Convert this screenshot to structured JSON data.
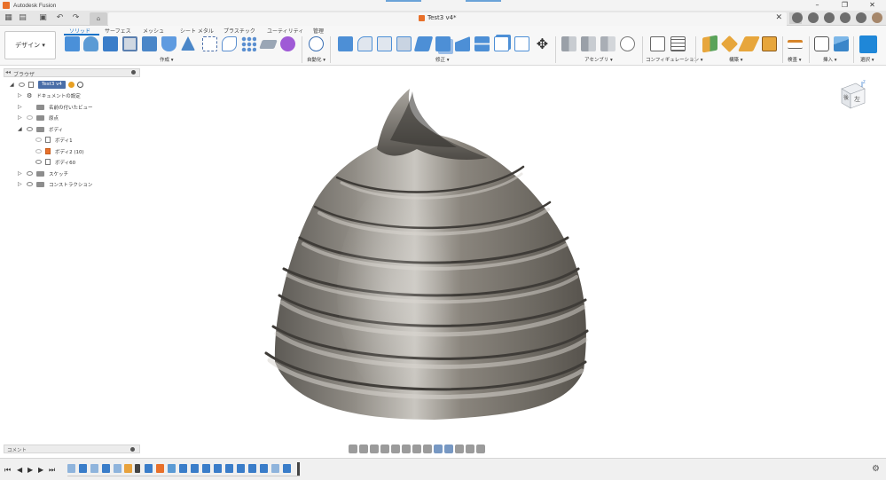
{
  "window": {
    "title": "Autodesk Fusion"
  },
  "document": {
    "tab_title": "Test3 v4*"
  },
  "ribbon": {
    "workspace_button": "デザイン ▾",
    "tabs": [
      "ソリッド",
      "サーフェス",
      "メッシュ",
      "シート メタル",
      "プラスチック",
      "ユーティリティ",
      "管理"
    ],
    "active_tab": "ソリッド",
    "groups": [
      "作成 ▾",
      "自動化 ▾",
      "修正 ▾",
      "アセンブリ ▾",
      "コンフィギュレーション ▾",
      "構築 ▾",
      "検査 ▾",
      "挿入 ▾",
      "選択 ▾"
    ]
  },
  "browser": {
    "title": "ブラウザ",
    "root": "Test3 v4",
    "items": [
      {
        "label": "ドキュメントの設定"
      },
      {
        "label": "名前の付いたビュー"
      },
      {
        "label": "原点"
      },
      {
        "label": "ボディ"
      },
      {
        "label": "ボディ1"
      },
      {
        "label": "ボディ2 (10)"
      },
      {
        "label": "ボディ60"
      },
      {
        "label": "スケッチ"
      },
      {
        "label": "コンストラクション"
      }
    ]
  },
  "viewcube": {
    "face_back": "後",
    "face_left": "左",
    "axis_z": "Z"
  },
  "comments": {
    "title": "コメント"
  },
  "colors": {
    "accent": "#1a73c8",
    "brand_orange": "#e8702a",
    "model_base": "#8a857d"
  }
}
